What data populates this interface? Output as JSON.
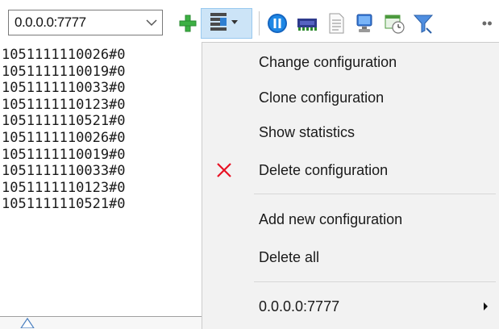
{
  "toolbar": {
    "address_value": "0.0.0.0:7777",
    "icons": [
      "add-icon",
      "configuration-menu-icon",
      "pause-icon",
      "network-card-icon",
      "document-icon",
      "computer-icon",
      "schedule-icon",
      "filter-icon"
    ]
  },
  "log": {
    "lines": [
      "1051111110026#0",
      "1051111110019#0",
      "1051111110033#0",
      "1051111110123#0",
      "1051111110521#0",
      "1051111110026#0",
      "1051111110019#0",
      "1051111110033#0",
      "1051111110123#0",
      "1051111110521#0"
    ]
  },
  "menu": {
    "change_configuration": "Change configuration",
    "clone_configuration": "Clone configuration",
    "show_statistics": "Show statistics",
    "delete_configuration": "Delete configuration",
    "add_new_configuration": "Add new configuration",
    "delete_all": "Delete all",
    "submenu_address": "0.0.0.0:7777"
  },
  "colors": {
    "menu_background": "#f2f2f2",
    "button_highlight": "#cce4f7",
    "delete_icon": "#e81123",
    "add_icon": "#3cb043",
    "pause_icon": "#1565c0"
  }
}
